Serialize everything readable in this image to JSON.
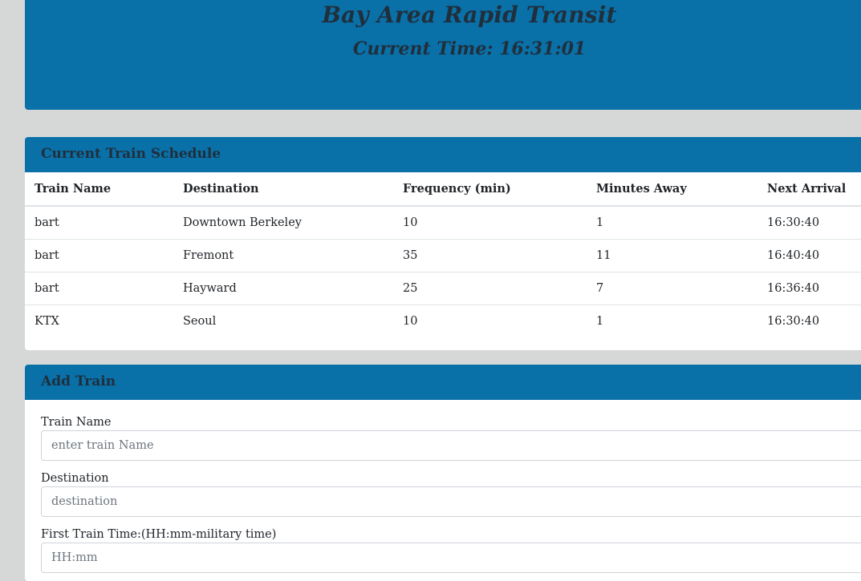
{
  "header": {
    "title": "Bay Area Rapid Transit",
    "current_time": "Current Time: 16:31:01"
  },
  "schedule": {
    "title": "Current Train Schedule",
    "columns": [
      "Train Name",
      "Destination",
      "Frequency (min)",
      "Minutes Away",
      "Next Arrival"
    ],
    "rows": [
      [
        "bart",
        "Downtown Berkeley",
        "10",
        "1",
        "16:30:40"
      ],
      [
        "bart",
        "Fremont",
        "35",
        "11",
        "16:40:40"
      ],
      [
        "bart",
        "Hayward",
        "25",
        "7",
        "16:36:40"
      ],
      [
        "KTX",
        "Seoul",
        "10",
        "1",
        "16:30:40"
      ]
    ]
  },
  "add_train": {
    "title": "Add Train",
    "fields": [
      {
        "label": "Train Name",
        "placeholder": "enter train Name",
        "value": ""
      },
      {
        "label": "Destination",
        "placeholder": "destination",
        "value": ""
      },
      {
        "label": "First Train Time:(HH:mm-military time)",
        "placeholder": "HH:mm",
        "value": ""
      }
    ]
  },
  "colors": {
    "background": "#d6d7d7",
    "primary": "#0a70a8",
    "heading_text": "#1f2f3c"
  }
}
